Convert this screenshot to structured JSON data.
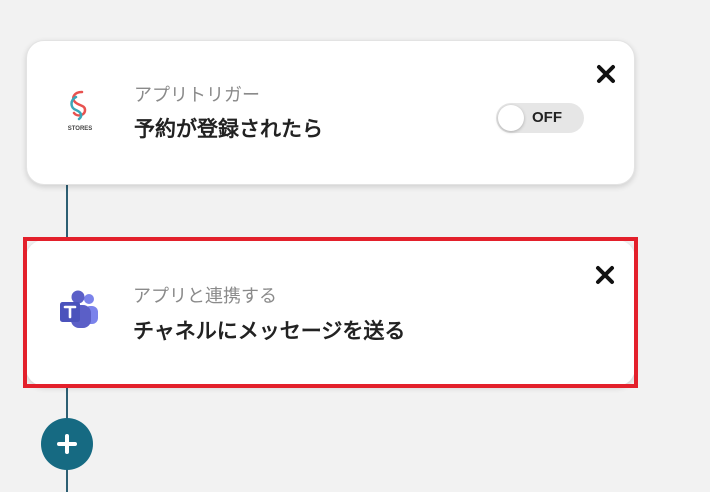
{
  "steps": [
    {
      "app_name": "STORES",
      "icon": "stores-logo-icon",
      "subtitle": "アプリトリガー",
      "title": "予約が登録されたら",
      "toggle_label": "OFF",
      "toggle_state": "off"
    },
    {
      "app_name": "Microsoft Teams",
      "icon": "teams-logo-icon",
      "subtitle": "アプリと連携する",
      "title": "チャネルにメッセージを送る",
      "highlighted": true
    }
  ],
  "colors": {
    "connector": "#2d5f73",
    "add_button": "#166a82",
    "highlight_border": "#e3202b",
    "teams_purple": "#5b5fc7"
  },
  "add_button_icon": "plus-icon",
  "close_icon": "close-icon"
}
